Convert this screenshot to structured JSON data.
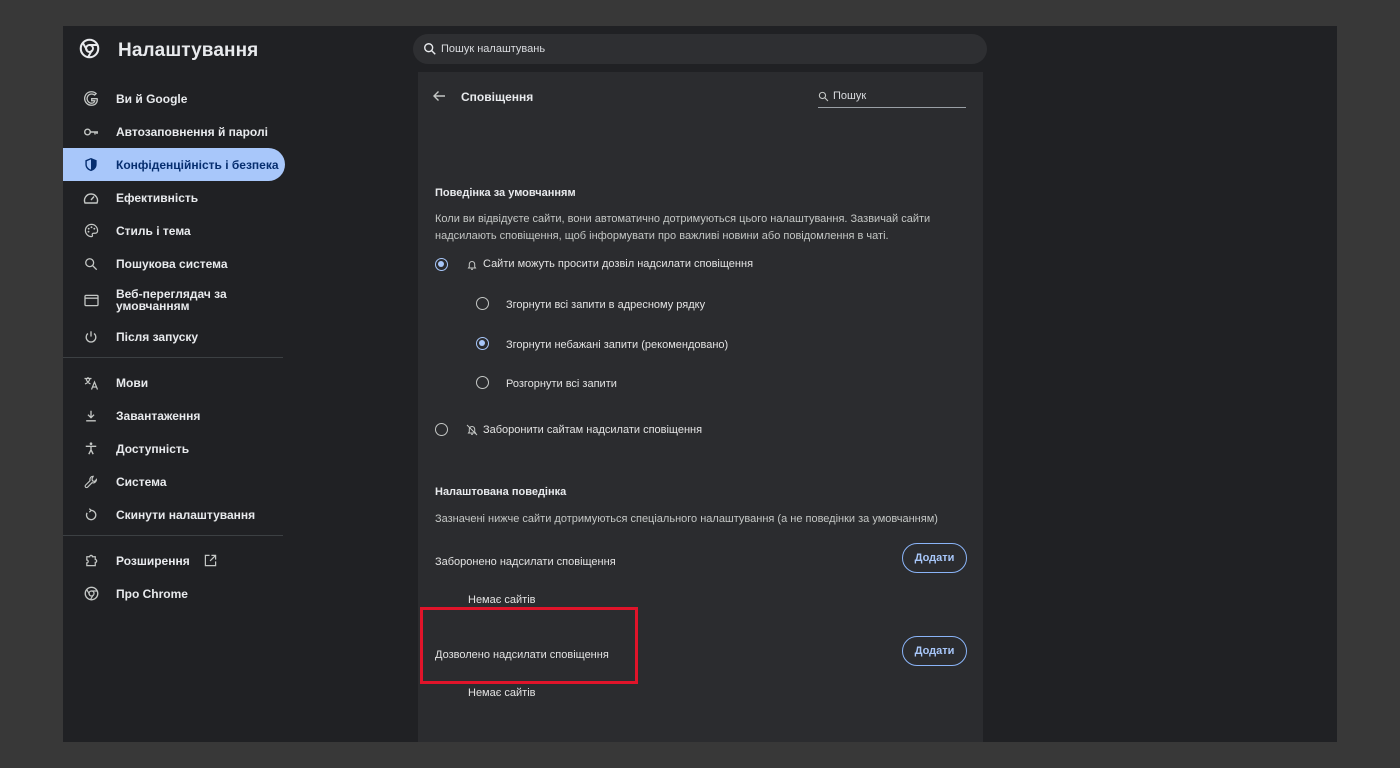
{
  "header": {
    "title": "Налаштування",
    "search_placeholder": "Пошук налаштувань"
  },
  "sidebar": {
    "items": [
      {
        "label": "Ви й Google",
        "icon": "google-g-icon"
      },
      {
        "label": "Автозаповнення й паролі",
        "icon": "key-icon"
      },
      {
        "label": "Конфіденційність і безпека",
        "icon": "shield-icon",
        "active": true
      },
      {
        "label": "Ефективність",
        "icon": "speedometer-icon"
      },
      {
        "label": "Стиль і тема",
        "icon": "palette-icon"
      },
      {
        "label": "Пошукова система",
        "icon": "search-icon"
      },
      {
        "label": "Веб-переглядач за умовчанням",
        "icon": "browser-window-icon"
      },
      {
        "label": "Після запуску",
        "icon": "power-icon"
      },
      {
        "label": "Мови",
        "icon": "translate-icon"
      },
      {
        "label": "Завантаження",
        "icon": "download-icon"
      },
      {
        "label": "Доступність",
        "icon": "accessibility-icon"
      },
      {
        "label": "Система",
        "icon": "wrench-icon"
      },
      {
        "label": "Скинути налаштування",
        "icon": "reset-icon"
      },
      {
        "label": "Розширення",
        "icon": "puzzle-icon"
      },
      {
        "label": "Про Chrome",
        "icon": "chrome-icon"
      }
    ]
  },
  "page": {
    "title": "Сповіщення",
    "search_placeholder": "Пошук",
    "default_section": {
      "heading": "Поведінка за умовчанням",
      "description": "Коли ви відвідуєте сайти, вони автоматично дотримуються цього налаштування. Зазвичай сайти надсилають сповіщення, щоб інформувати про важливі новини або повідомлення в чаті.",
      "allow_option": "Сайти можуть просити дозвіл надсилати сповіщення",
      "sub_options": [
        "Згорнути всі запити в адресному рядку",
        "Згорнути небажані запити (рекомендовано)",
        "Розгорнути всі запити"
      ],
      "selected_sub_option": 1,
      "block_option": "Заборонити сайтам надсилати сповіщення"
    },
    "custom_section": {
      "heading": "Налаштована поведінка",
      "description": "Зазначені нижче сайти дотримуються спеціального налаштування (а не поведінки за умовчанням)",
      "blocked_label": "Заборонено надсилати сповіщення",
      "blocked_empty": "Немає сайтів",
      "allowed_label": "Дозволено надсилати сповіщення",
      "allowed_empty": "Немає сайтів",
      "add_label": "Додати"
    }
  },
  "colors": {
    "accent": "#a8c7fa",
    "highlight": "#e0142a",
    "background": "#202124",
    "card": "#2b2c2f"
  }
}
